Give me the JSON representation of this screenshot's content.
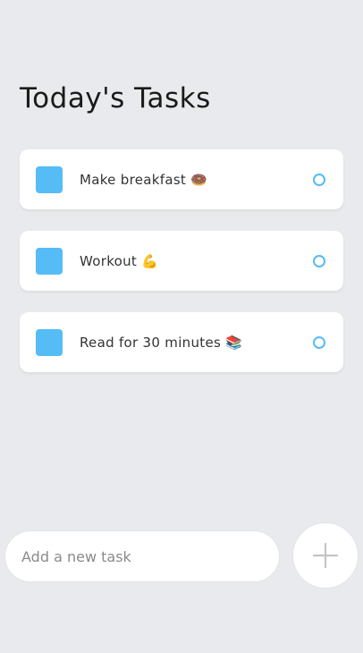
{
  "header": {
    "title": "Today's Tasks"
  },
  "tasks": [
    {
      "text": "Make breakfast 🍩"
    },
    {
      "text": "Workout 💪"
    },
    {
      "text": "Read for 30 minutes 📚"
    }
  ],
  "new_task": {
    "placeholder": "Add a new task",
    "value": ""
  },
  "add_button": {
    "icon": "plus-icon"
  },
  "colors": {
    "background": "#e8eaed",
    "accent": "#55bcf6",
    "card": "#ffffff"
  }
}
